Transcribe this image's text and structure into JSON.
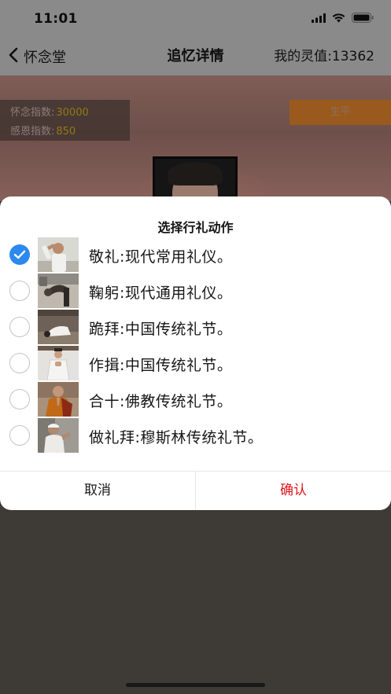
{
  "status_bar": {
    "time": "11:01",
    "icons": [
      "signal-icon",
      "wifi-icon",
      "battery-icon"
    ]
  },
  "nav": {
    "back_label": "怀念堂",
    "title": "追忆详情",
    "right_text": "我的灵值:13362"
  },
  "memorial": {
    "stats": [
      {
        "label": "怀念指数:",
        "value": "30000"
      },
      {
        "label": "感恩指数:",
        "value": "850"
      }
    ],
    "bio_button": "生平"
  },
  "dialog": {
    "title": "选择行礼动作",
    "options": [
      {
        "label": "敬礼:现代常用礼仪。",
        "checked": true
      },
      {
        "label": "鞠躬:现代通用礼仪。",
        "checked": false
      },
      {
        "label": "跪拜:中国传统礼节。",
        "checked": false
      },
      {
        "label": "作揖:中国传统礼节。",
        "checked": false
      },
      {
        "label": "合十:佛教传统礼节。",
        "checked": false
      },
      {
        "label": "做礼拜:穆斯林传统礼节。",
        "checked": false
      }
    ],
    "cancel_label": "取消",
    "confirm_label": "确认"
  },
  "colors": {
    "accent_blue": "#2b89ef",
    "confirm_red": "#e0151d",
    "stat_value": "#8e7a16",
    "bio_button": "#9a5a1e"
  }
}
